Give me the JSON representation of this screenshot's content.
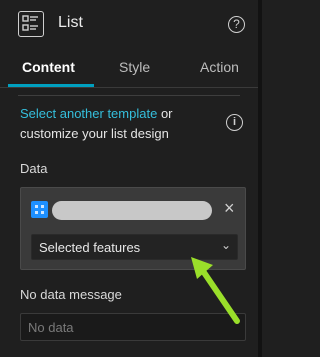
{
  "header": {
    "title": "List",
    "help_icon": "help-circle-icon",
    "help_glyph": "?"
  },
  "tabs": [
    {
      "label": "Content",
      "active": true
    },
    {
      "label": "Style",
      "active": false
    },
    {
      "label": "Action",
      "active": false
    }
  ],
  "template": {
    "link_text": "Select another template",
    "rest_text": "or customize your list design",
    "info_icon": "info-icon",
    "info_glyph": "i"
  },
  "data_section": {
    "label": "Data",
    "source_icon": "feature-layer-icon",
    "remove_glyph": "×",
    "select_value": "Selected features",
    "chevron_glyph": "⌄"
  },
  "no_data": {
    "label": "No data message",
    "placeholder": "No data"
  },
  "colors": {
    "background": "#1f1f1f",
    "accent": "#00a0c0",
    "link": "#35bfdc",
    "annotation_arrow": "#9adf2a"
  }
}
